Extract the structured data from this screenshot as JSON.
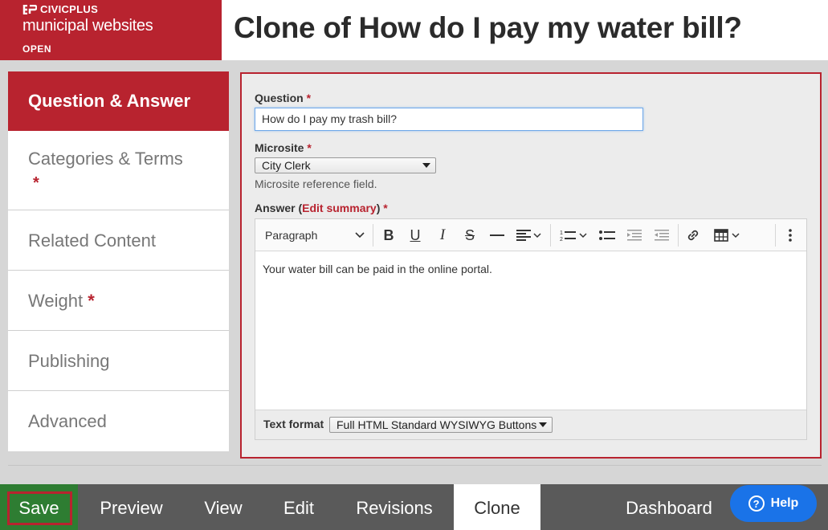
{
  "brand": {
    "company": "CIVICPLUS",
    "product": "municipal websites",
    "tag": "OPEN",
    "logo_icon": "civicplus-logo-icon"
  },
  "page": {
    "title": "Clone of How do I pay my water bill?"
  },
  "sidebar": {
    "items": [
      {
        "label": "Question & Answer",
        "required": false,
        "active": true
      },
      {
        "label": "Categories & Terms",
        "required": true
      },
      {
        "label": "Related Content",
        "required": false
      },
      {
        "label": "Weight",
        "required": true
      },
      {
        "label": "Publishing",
        "required": false
      },
      {
        "label": "Advanced",
        "required": false
      }
    ],
    "required_mark": "*"
  },
  "form": {
    "question": {
      "label": "Question",
      "value": "How do I pay my trash bill?",
      "required_mark": "*"
    },
    "microsite": {
      "label": "Microsite",
      "value": "City Clerk",
      "help": "Microsite reference field.",
      "required_mark": "*"
    },
    "answer": {
      "label": "Answer (",
      "edit_summary": "Edit summary",
      "label_close": ")",
      "required_mark": "*",
      "content": "Your water bill can be paid in the online portal.",
      "toolbar": {
        "paragraph": "Paragraph",
        "icons": [
          "bold-icon",
          "underline-icon",
          "italic-icon",
          "strikethrough-icon",
          "horizontal-line-icon",
          "align-icon",
          "numbered-list-icon",
          "bulleted-list-icon",
          "indent-icon",
          "outdent-icon",
          "link-icon",
          "table-icon",
          "more-icon"
        ]
      },
      "text_format_label": "Text format",
      "text_format_value": "Full HTML Standard WYSIWYG Buttons"
    }
  },
  "bottombar": {
    "save": "Save",
    "preview": "Preview",
    "view": "View",
    "edit": "Edit",
    "revisions": "Revisions",
    "clone": "Clone",
    "dashboard": "Dashboard",
    "help": "Help"
  },
  "colors": {
    "brand_red": "#b8232f",
    "save_green": "#2e7d32",
    "help_blue": "#1a73e8"
  }
}
